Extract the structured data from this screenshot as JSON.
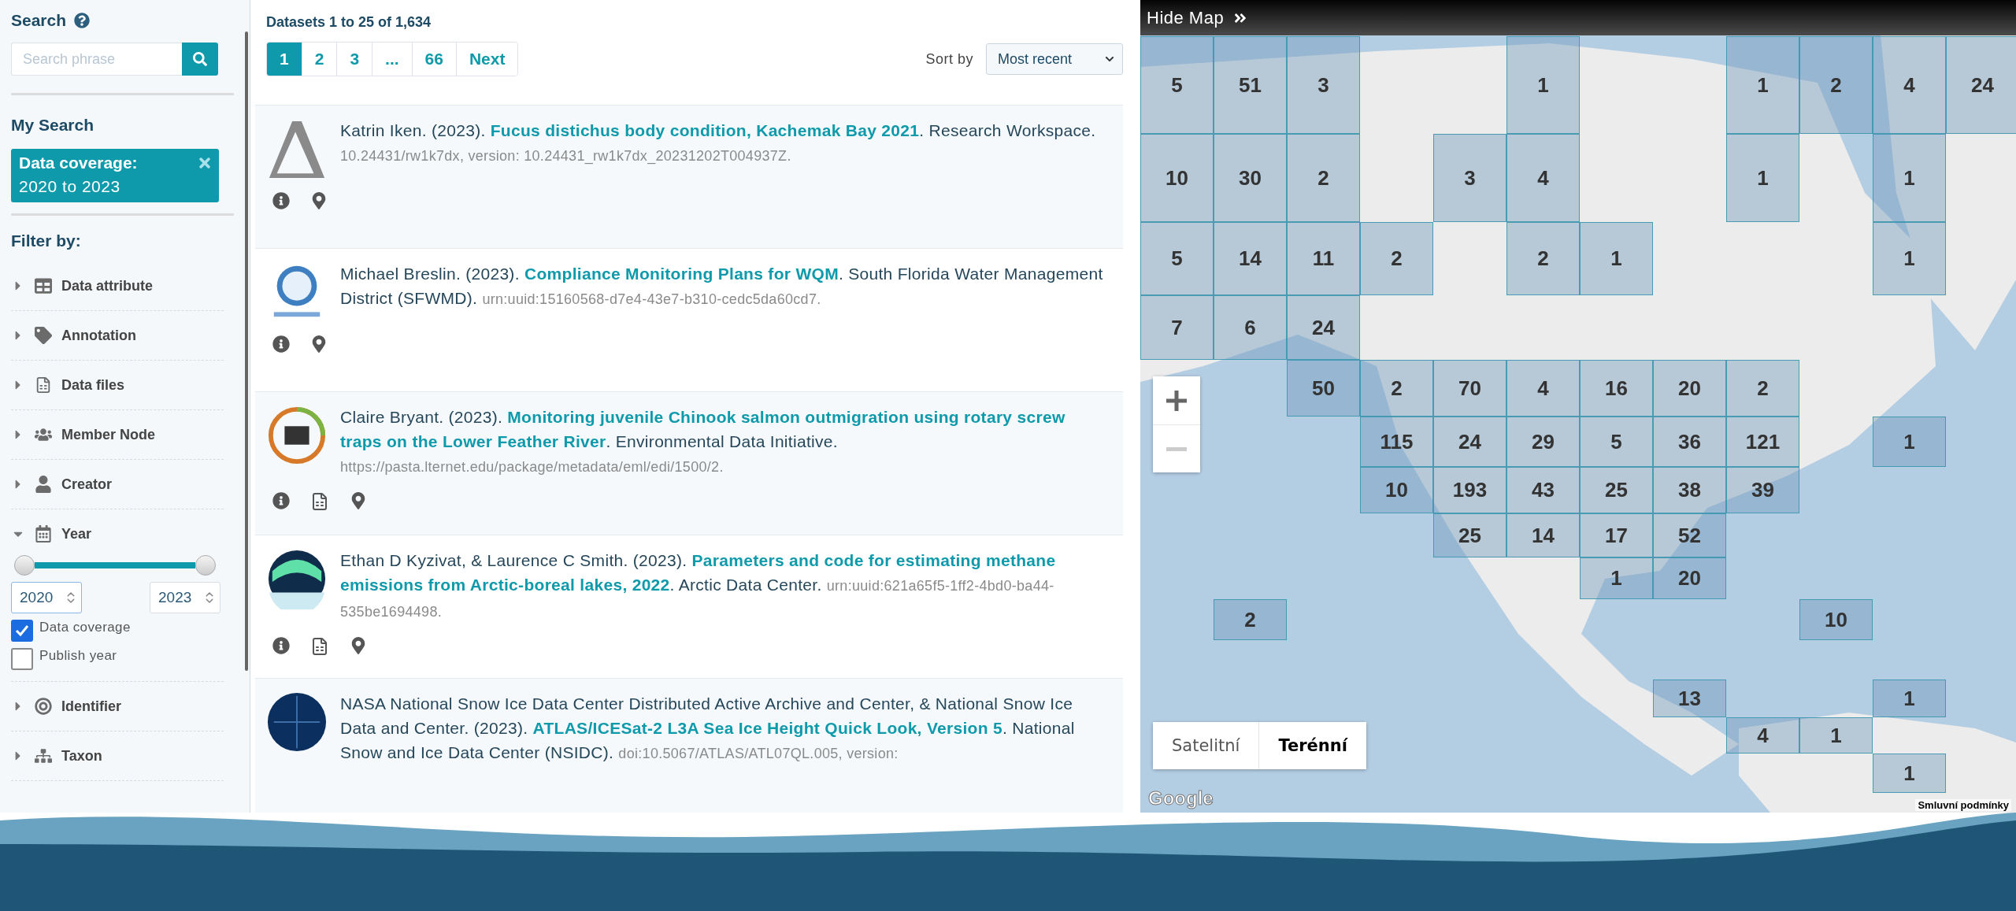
{
  "sidebar": {
    "search_title": "Search",
    "search": {
      "placeholder": "Search phrase"
    },
    "my_search_title": "My Search",
    "filter_tags": [
      {
        "label": "Data coverage:",
        "value": "2020 to 2023"
      }
    ],
    "filter_title": "Filter by:",
    "filters": [
      {
        "label": "Data attribute",
        "expanded": false
      },
      {
        "label": "Annotation",
        "expanded": false
      },
      {
        "label": "Data files",
        "expanded": false
      },
      {
        "label": "Member Node",
        "expanded": false
      },
      {
        "label": "Creator",
        "expanded": false
      },
      {
        "label": "Year",
        "expanded": true,
        "range": {
          "level": 1,
          "from": "2020",
          "to": "2023"
        },
        "options": [
          {
            "label": "Data coverage",
            "checked": true
          },
          {
            "label": "Publish year",
            "checked": false
          }
        ]
      },
      {
        "label": "Identifier",
        "expanded": false
      },
      {
        "label": "Taxon",
        "expanded": false
      }
    ]
  },
  "results": {
    "summary": "Datasets 1 to 25 of 1,634",
    "pages": [
      {
        "label": "1",
        "selected": true
      },
      {
        "label": "2",
        "selected": false
      },
      {
        "label": "3",
        "selected": false
      },
      {
        "label": "...",
        "selected": false
      },
      {
        "label": "66",
        "selected": false
      },
      {
        "label": "Next",
        "selected": false
      }
    ],
    "sort": {
      "label": "Sort by",
      "value": "Most recent"
    },
    "items": [
      {
        "citation": "Katrin Iken. (2023). **Fucus distichus body condition, Kachemak Bay 2021**. Research Workspace. *10.24431/rw1k7dx, version: 10.24431_rw1k7dx_20231202T004937Z.*",
        "data_files": false
      },
      {
        "citation": "Michael Breslin. (2023). **Compliance Monitoring Plans for WQM**. South Florida Water Management District (SFWMD). *urn:uuid:15160568-d7e4-43e7-b310-cedc5da60cd7.*",
        "data_files": false
      },
      {
        "citation": "Claire Bryant. (2023). **Monitoring juvenile Chinook salmon outmigration using rotary screw traps on the Lower Feather River**. Environmental Data Initiative. *https://pasta.lternet.edu/package/metadata/eml/edi/1500/2.*",
        "data_files": true
      },
      {
        "citation": "Ethan D Kyzivat, & Laurence C Smith. (2023). **Parameters and code for estimating methane emissions from Arctic-boreal lakes, 2022**. Arctic Data Center. *urn:uuid:621a65f5-1ff2-4bd0-ba44-535be1694498.*",
        "data_files": true
      },
      {
        "citation": "NASA National Snow Ice Data Center Distributed Active Archive and Center, & National Snow Ice Data and Center. (2023). **ATLAS/ICESat-2 L3A Sea Ice Height Quick Look, Version 5**. National Snow and Ice Data Center (NSIDC). *doi:10.5067/ATLAS/ATL07QL.005, version:*"
      }
    ]
  },
  "map": {
    "toggle": "Hide Map",
    "cells": [
      {
        "count": "5"
      },
      {
        "count": "51"
      },
      {
        "count": "3"
      },
      {
        "count": "1"
      },
      {
        "count": "1"
      },
      {
        "count": "2"
      },
      {
        "count": "4"
      },
      {
        "count": "24"
      },
      {
        "count": "10"
      },
      {
        "count": "30"
      },
      {
        "count": "2"
      },
      {
        "count": "3"
      },
      {
        "count": "4"
      },
      {
        "count": "1"
      },
      {
        "count": "1"
      },
      {
        "count": "5"
      },
      {
        "count": "14"
      },
      {
        "count": "11"
      },
      {
        "count": "2"
      },
      {
        "count": "2"
      },
      {
        "count": "1"
      },
      {
        "count": "1"
      },
      {
        "count": "7"
      },
      {
        "count": "6"
      },
      {
        "count": "24"
      },
      {
        "count": "50"
      },
      {
        "count": "2"
      },
      {
        "count": "70"
      },
      {
        "count": "4"
      },
      {
        "count": "16"
      },
      {
        "count": "20"
      },
      {
        "count": "2"
      },
      {
        "count": "115"
      },
      {
        "count": "24"
      },
      {
        "count": "29"
      },
      {
        "count": "5"
      },
      {
        "count": "36"
      },
      {
        "count": "121"
      },
      {
        "count": "1"
      },
      {
        "count": "10"
      },
      {
        "count": "193"
      },
      {
        "count": "43"
      },
      {
        "count": "25"
      },
      {
        "count": "38"
      },
      {
        "count": "39"
      },
      {
        "count": "25"
      },
      {
        "count": "14"
      },
      {
        "count": "17"
      },
      {
        "count": "52"
      },
      {
        "count": "1"
      },
      {
        "count": "20"
      },
      {
        "count": "2"
      },
      {
        "count": "10"
      },
      {
        "count": "13"
      },
      {
        "count": "1"
      },
      {
        "count": "4"
      },
      {
        "count": "1"
      },
      {
        "count": "1"
      }
    ],
    "map_types": [
      {
        "label": "Satelitní",
        "selected": false
      },
      {
        "label": "Terénní",
        "selected": true
      }
    ],
    "logo": "Google",
    "terms": "Smluvní podmínky"
  }
}
